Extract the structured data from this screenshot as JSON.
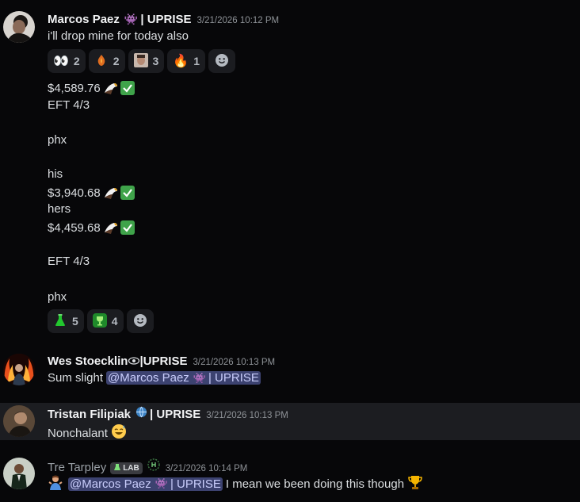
{
  "messages": [
    {
      "author": "Marcos Paez",
      "tag": "| UPRISE",
      "timestamp": "3/21/2026 10:12 PM",
      "first_line": "i'll drop mine for today also",
      "reactions_top": [
        {
          "icon": "eyes-icon",
          "count": "2"
        },
        {
          "icon": "phoenix-icon",
          "count": "2"
        },
        {
          "icon": "face-photo-icon",
          "count": "3"
        },
        {
          "icon": "fire-icon",
          "count": "1"
        }
      ],
      "lines": [
        "$4,589.76",
        "EFT 4/3",
        "phx",
        "his",
        "$3,940.68",
        "hers",
        "$4,459.68",
        "EFT 4/3",
        "phx"
      ],
      "reactions_bottom": [
        {
          "icon": "flask-icon",
          "count": "5"
        },
        {
          "icon": "trophy-badge-icon",
          "count": "4"
        }
      ]
    },
    {
      "author": "Wes Stoecklin",
      "tag": "|UPRISE",
      "timestamp": "3/21/2026 10:13 PM",
      "text": "Sum slight",
      "mention": "@Marcos Paez",
      "mention_tag": "| UPRISE"
    },
    {
      "author": "Tristan Filipiak",
      "tag": "| UPRISE",
      "timestamp": "3/21/2026 10:13 PM",
      "text": "Nonchalant"
    },
    {
      "author": "Tre Tarpley",
      "badge": "LAB",
      "timestamp": "3/21/2026 10:14 PM",
      "mention": "@Marcos Paez",
      "mention_tag": "| UPRISE",
      "text": "I mean we been doing this though"
    }
  ]
}
